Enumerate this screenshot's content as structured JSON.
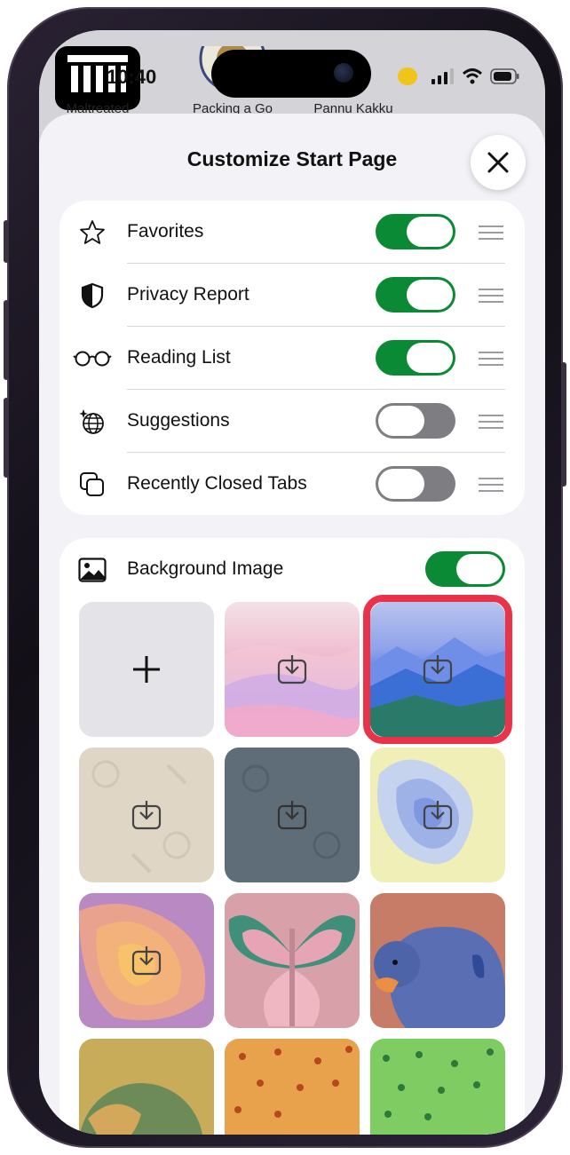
{
  "status_bar": {
    "time": "10:40"
  },
  "favorites_bar": {
    "items": [
      {
        "label": "Maltreated"
      },
      {
        "label": "Packing a Go"
      },
      {
        "label": "Pannu Kakku"
      }
    ]
  },
  "sheet": {
    "title": "Customize Start Page",
    "sections": [
      {
        "label": "Favorites",
        "icon": "star-icon",
        "enabled": true
      },
      {
        "label": "Privacy Report",
        "icon": "shield-icon",
        "enabled": true
      },
      {
        "label": "Reading List",
        "icon": "glasses-icon",
        "enabled": true
      },
      {
        "label": "Suggestions",
        "icon": "globe-sparkle-icon",
        "enabled": false
      },
      {
        "label": "Recently Closed Tabs",
        "icon": "tabs-icon",
        "enabled": false
      }
    ],
    "background": {
      "label": "Background Image",
      "enabled": true,
      "selected_index": 2
    }
  },
  "colors": {
    "toggle_on": "#0b8a35",
    "selection": "#e8334a"
  }
}
